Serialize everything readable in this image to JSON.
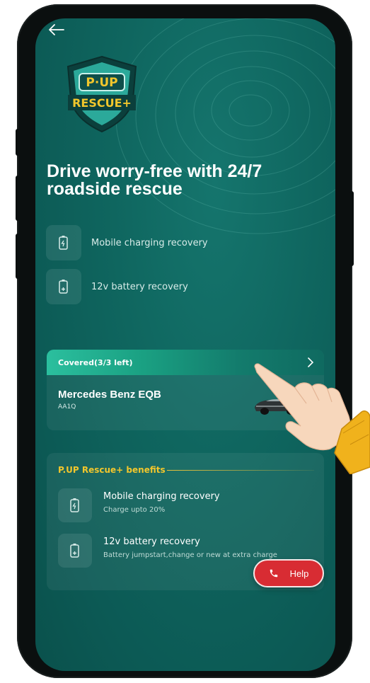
{
  "logo": {
    "brand_line": "P·UP",
    "product_line": "RESCUE+"
  },
  "hero": {
    "title": "Drive worry-free with 24/7 roadside rescue"
  },
  "features": [
    {
      "label": "Mobile charging recovery",
      "icon": "mobile-charging-icon"
    },
    {
      "label": "12v battery recovery",
      "icon": "battery-plus-icon"
    }
  ],
  "coverage": {
    "status": "Covered(3/3 left)",
    "car_name": "Mercedes Benz EQB",
    "plate": "AA1Q"
  },
  "benefits": {
    "heading": "P.UP Rescue+ benefits",
    "items": [
      {
        "title": "Mobile charging recovery",
        "subtitle": "Charge upto 20%",
        "icon": "mobile-charging-icon"
      },
      {
        "title": "12v battery recovery",
        "subtitle": "Battery jumpstart,change or new at extra charge",
        "icon": "battery-plus-icon"
      }
    ]
  },
  "help": {
    "label": "Help",
    "icon": "phone-icon"
  },
  "colors": {
    "background": "#0f665f",
    "accent_gold": "#f2c62c",
    "help_red": "#d82c33",
    "covered_bar": "#1aa082"
  }
}
